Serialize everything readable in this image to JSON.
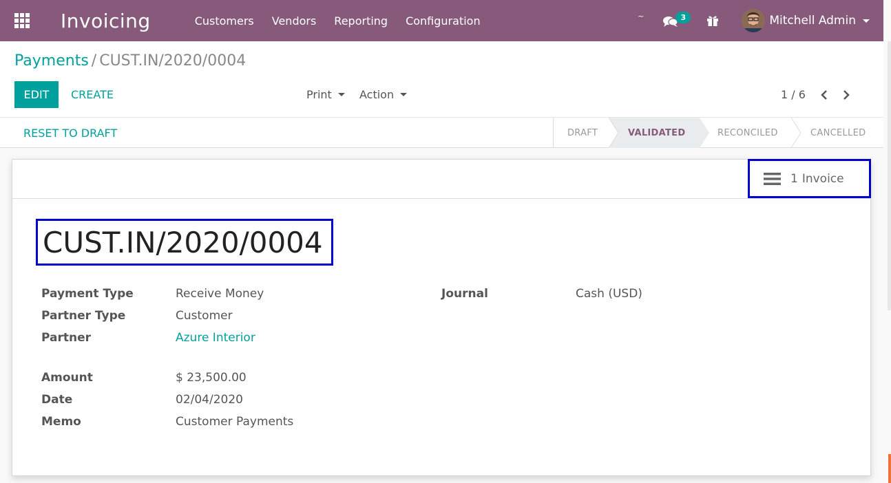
{
  "navbar": {
    "app_title": "Invoicing",
    "menu": [
      {
        "label": "Customers"
      },
      {
        "label": "Vendors"
      },
      {
        "label": "Reporting"
      },
      {
        "label": "Configuration"
      }
    ],
    "tilde": "~",
    "messages_badge": "3",
    "user_name": "Mitchell Admin",
    "brand_color": "#875a7b",
    "accent_color": "#00a09d"
  },
  "control_panel": {
    "breadcrumb_parent": "Payments",
    "breadcrumb_sep": "/",
    "breadcrumb_current": "CUST.IN/2020/0004",
    "edit_label": "EDIT",
    "create_label": "CREATE",
    "print_label": "Print",
    "action_label": "Action",
    "pager": "1 / 6"
  },
  "statusbar": {
    "reset_label": "RESET TO DRAFT",
    "stages": [
      {
        "label": "DRAFT",
        "active": false
      },
      {
        "label": "VALIDATED",
        "active": true
      },
      {
        "label": "RECONCILED",
        "active": false
      },
      {
        "label": "CANCELLED",
        "active": false
      }
    ]
  },
  "sheet": {
    "invoice_button": {
      "count": "1",
      "label": "Invoice"
    },
    "title": "CUST.IN/2020/0004",
    "left_fields": [
      {
        "label": "Payment Type",
        "value": "Receive Money"
      },
      {
        "label": "Partner Type",
        "value": "Customer"
      },
      {
        "label": "Partner",
        "value": "Azure Interior"
      },
      {
        "label": "Amount",
        "value": "$ 23,500.00"
      },
      {
        "label": "Date",
        "value": "02/04/2020"
      },
      {
        "label": "Memo",
        "value": "Customer Payments"
      }
    ],
    "right_fields": [
      {
        "label": "Journal",
        "value": "Cash (USD)"
      }
    ]
  }
}
